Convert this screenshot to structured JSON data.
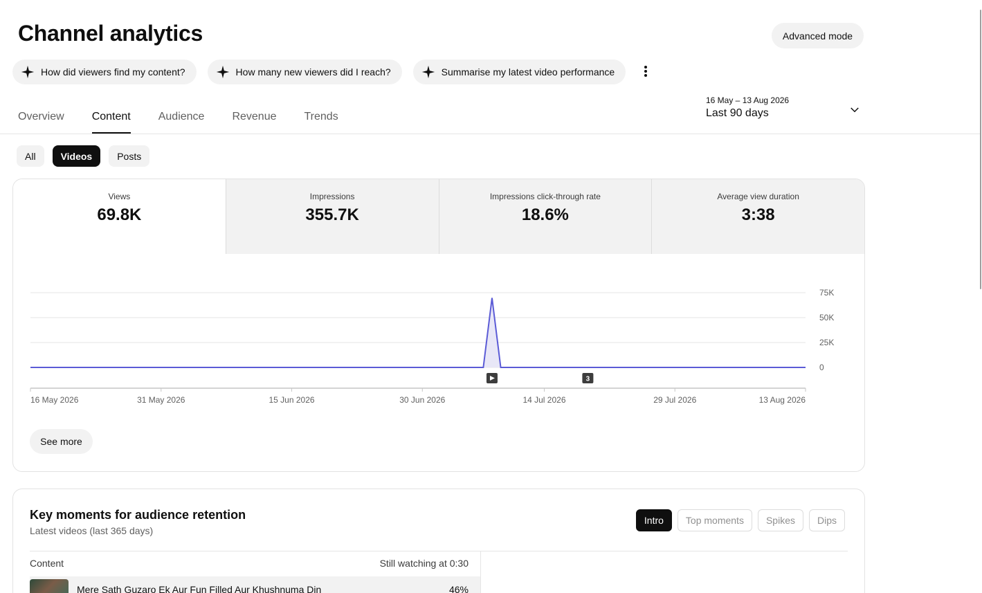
{
  "page": {
    "title": "Channel analytics",
    "advanced_label": "Advanced mode"
  },
  "chips": [
    {
      "label": "How did viewers find my content?"
    },
    {
      "label": "How many new viewers did I reach?"
    },
    {
      "label": "Summarise my latest video performance"
    }
  ],
  "tabs": [
    {
      "label": "Overview",
      "active": false
    },
    {
      "label": "Content",
      "active": true
    },
    {
      "label": "Audience",
      "active": false
    },
    {
      "label": "Revenue",
      "active": false
    },
    {
      "label": "Trends",
      "active": false
    }
  ],
  "date_range": {
    "dates": "16 May – 13 Aug 2026",
    "label": "Last 90 days"
  },
  "filters": [
    {
      "label": "All",
      "active": false
    },
    {
      "label": "Videos",
      "active": true
    },
    {
      "label": "Posts",
      "active": false
    }
  ],
  "metrics": [
    {
      "label": "Views",
      "value": "69.8K",
      "active": true
    },
    {
      "label": "Impressions",
      "value": "355.7K",
      "active": false
    },
    {
      "label": "Impressions click-through rate",
      "value": "18.6%",
      "active": false
    },
    {
      "label": "Average view duration",
      "value": "3:38",
      "active": false
    }
  ],
  "chart_data": {
    "type": "area",
    "x_tick_labels": [
      "16 May 2026",
      "31 May 2026",
      "15 Jun 2026",
      "30 Jun 2026",
      "14 Jul 2026",
      "29 Jul 2026",
      "13 Aug 2026"
    ],
    "y_tick_labels": [
      "0",
      "25K",
      "50K",
      "75K"
    ],
    "ylim": [
      0,
      75000
    ],
    "grid": true,
    "color": "#5b5bd6",
    "fill": "#e8e7f7",
    "points": [
      {
        "x": "16 May 2026",
        "y": 0
      },
      {
        "x": "7 Jul 2026",
        "y": 0
      },
      {
        "x": "8 Jul 2026",
        "y": 69800
      },
      {
        "x": "9 Jul 2026",
        "y": 0
      },
      {
        "x": "13 Aug 2026",
        "y": 0
      }
    ],
    "markers": [
      {
        "x": "8 Jul 2026",
        "type": "play-icon"
      },
      {
        "x": "19 Jul 2026",
        "label": "3"
      }
    ]
  },
  "see_more": "See more",
  "key_moments": {
    "title": "Key moments for audience retention",
    "subtitle": "Latest videos (last 365 days)",
    "toggles": [
      {
        "label": "Intro",
        "active": true
      },
      {
        "label": "Top moments",
        "active": false
      },
      {
        "label": "Spikes",
        "active": false
      },
      {
        "label": "Dips",
        "active": false
      }
    ],
    "col_content": "Content",
    "col_metric": "Still watching at 0:30",
    "rows": [
      {
        "title": "Mere Sath Guzaro Ek Aur Fun Filled Aur Khushnuma Din",
        "value": "46%"
      }
    ]
  }
}
